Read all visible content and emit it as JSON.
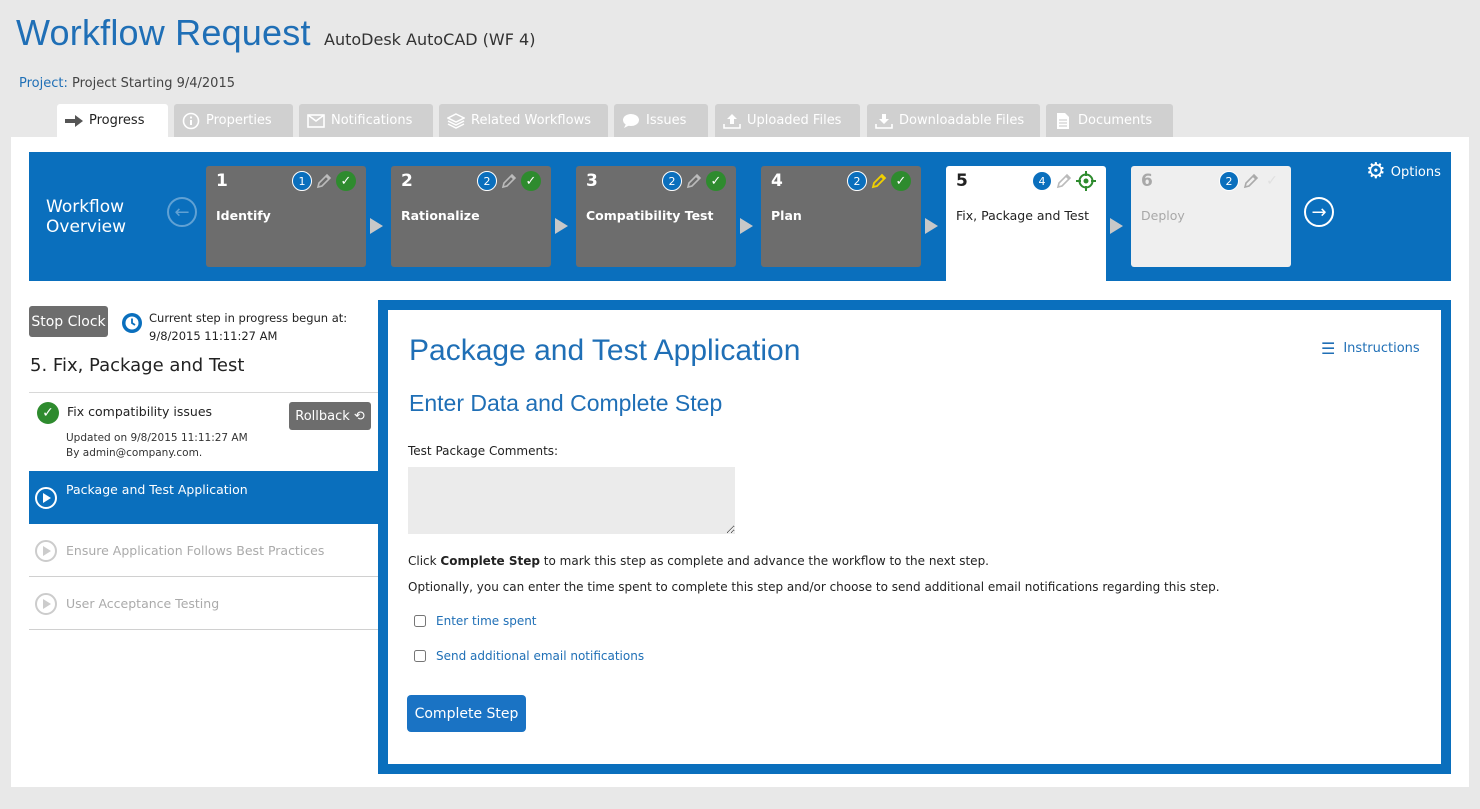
{
  "header": {
    "title": "Workflow Request",
    "subtitle": "AutoDesk AutoCAD (WF 4)",
    "project_label": "Project:",
    "project_value": "Project Starting 9/4/2015"
  },
  "tabs": [
    {
      "label": "Progress",
      "icon": "arrow-right-icon",
      "active": true
    },
    {
      "label": "Properties",
      "icon": "info-icon"
    },
    {
      "label": "Notifications",
      "icon": "envelope-icon"
    },
    {
      "label": "Related Workflows",
      "icon": "layers-icon"
    },
    {
      "label": "Issues",
      "icon": "speech-bubble-icon"
    },
    {
      "label": "Uploaded Files",
      "icon": "upload-icon"
    },
    {
      "label": "Downloadable Files",
      "icon": "download-icon"
    },
    {
      "label": "Documents",
      "icon": "document-icon"
    }
  ],
  "workflow": {
    "label_line1": "Workflow",
    "label_line2": "Overview",
    "options_label": "Options",
    "steps": [
      {
        "num": "1",
        "name": "Identify",
        "count": "1",
        "status": "complete"
      },
      {
        "num": "2",
        "name": "Rationalize",
        "count": "2",
        "status": "complete"
      },
      {
        "num": "3",
        "name": "Compatibility Test",
        "count": "2",
        "status": "complete"
      },
      {
        "num": "4",
        "name": "Plan",
        "count": "2",
        "status": "complete"
      },
      {
        "num": "5",
        "name": "Fix, Package and Test",
        "count": "4",
        "status": "current"
      },
      {
        "num": "6",
        "name": "Deploy",
        "count": "2",
        "status": "future"
      }
    ]
  },
  "sidebar": {
    "stop_clock_label": "Stop Clock",
    "progress_line1": "Current step in progress begun at:",
    "progress_line2": "9/8/2015 11:11:27 AM",
    "current_step_title": "5. Fix, Package and Test",
    "done_item": {
      "label": "Fix compatibility issues",
      "updated": "Updated on 9/8/2015 11:11:27 AM",
      "by": "By admin@company.com.",
      "rollback_label": "Rollback"
    },
    "items": [
      {
        "label": "Package and Test Application",
        "active": true
      },
      {
        "label": "Ensure Application Follows Best Practices"
      },
      {
        "label": "User Acceptance Testing"
      }
    ]
  },
  "content": {
    "title": "Package and Test Application",
    "subtitle": "Enter Data and Complete Step",
    "instructions_label": "Instructions",
    "field_label": "Test Package Comments:",
    "comments_value": "",
    "note1_prefix": "Click ",
    "note1_bold": "Complete Step",
    "note1_suffix": " to mark this step as complete and advance the workflow to the next step.",
    "note2": "Optionally, you can enter the time spent to complete this step and/or choose to send additional email notifications regarding this step.",
    "checkbox_time": "Enter time spent",
    "checkbox_email": "Send additional email notifications",
    "complete_button": "Complete Step"
  },
  "colors": {
    "brand_blue": "#0a6fbd",
    "title_blue": "#1f6fb6",
    "step_gray": "#6d6d6d",
    "success_green": "#2e8b2e",
    "edit_yellow": "#f0d000"
  }
}
